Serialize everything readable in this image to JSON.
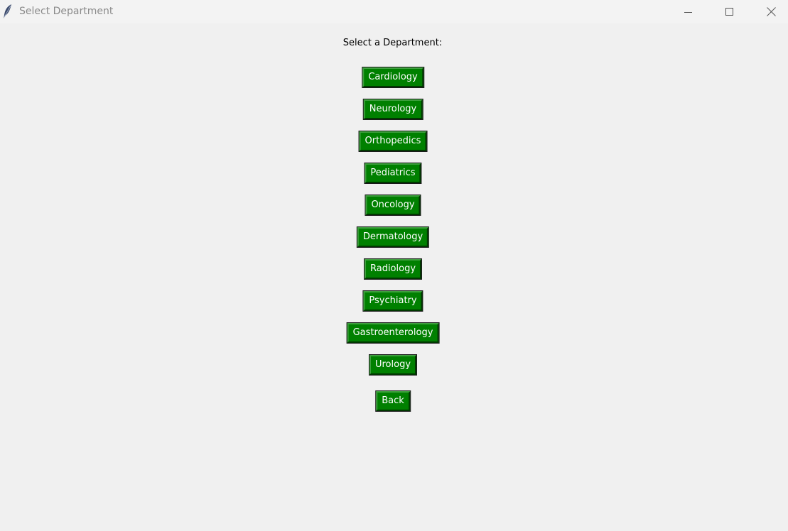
{
  "window": {
    "title": "Select Department",
    "icon": "feather-icon",
    "controls": {
      "minimize": "minimize-icon",
      "maximize": "maximize-icon",
      "close": "close-icon"
    }
  },
  "prompt": "Select a Department:",
  "departments": [
    "Cardiology",
    "Neurology",
    "Orthopedics",
    "Pediatrics",
    "Oncology",
    "Dermatology",
    "Radiology",
    "Psychiatry",
    "Gastroenterology",
    "Urology"
  ],
  "back_label": "Back",
  "colors": {
    "button_bg": "#008000",
    "button_text": "#ffffff",
    "window_bg": "#f0f0f0"
  }
}
